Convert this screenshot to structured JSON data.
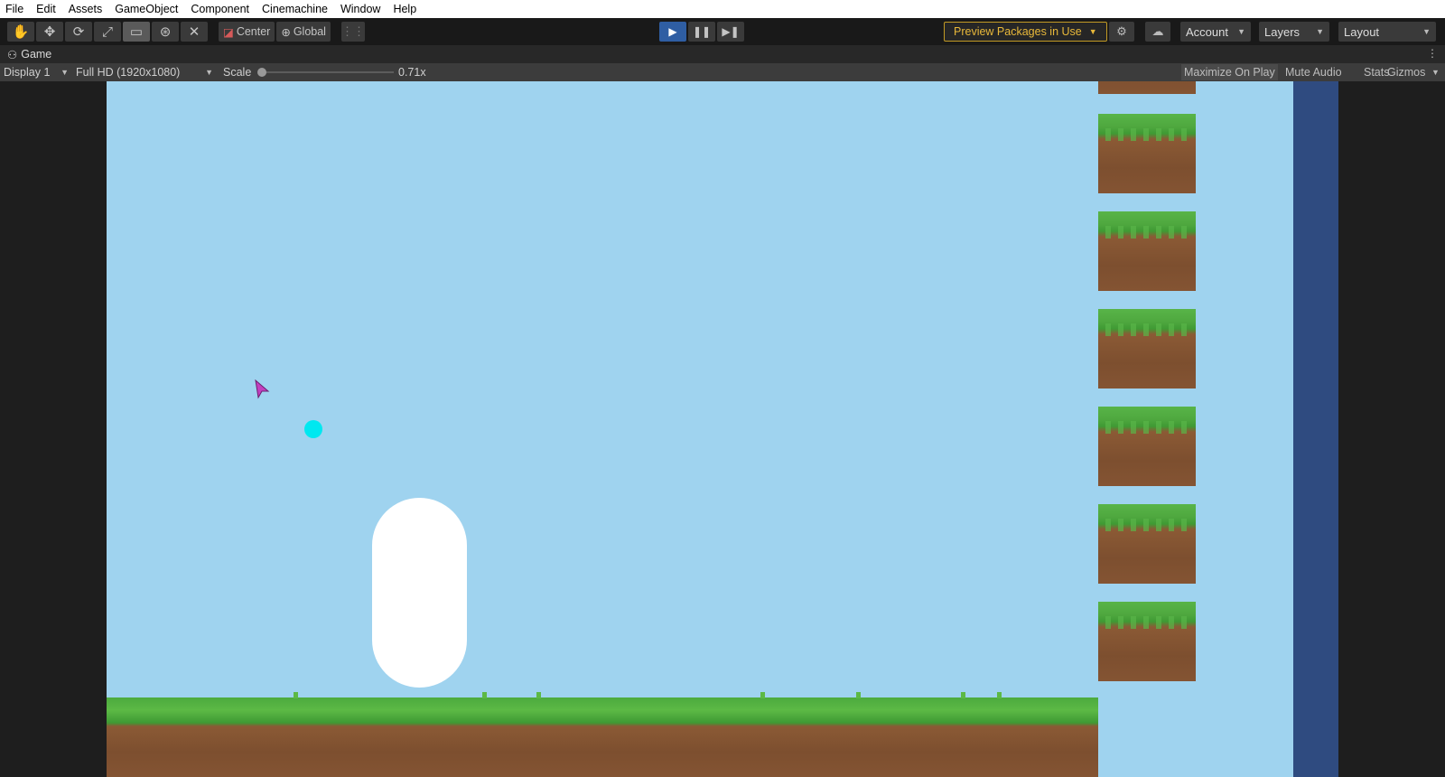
{
  "menu": [
    "File",
    "Edit",
    "Assets",
    "GameObject",
    "Component",
    "Cinemachine",
    "Window",
    "Help"
  ],
  "toolbar": {
    "tools": [
      "hand-tool-icon",
      "move-tool-icon",
      "rotate-tool-icon",
      "scale-tool-icon",
      "rect-tool-icon",
      "transform-tool-icon",
      "custom-tool-icon"
    ],
    "active_tool": "rect-tool-icon",
    "pivot_mode": "Center",
    "pivot_rotation": "Global",
    "play_state": "playing",
    "preview_packages": "Preview Packages in Use",
    "account": "Account",
    "layers": "Layers",
    "layout": "Layout"
  },
  "game_tab": {
    "title": "Game"
  },
  "game_bar": {
    "display": "Display 1",
    "resolution": "Full HD (1920x1080)",
    "scale_label": "Scale",
    "scale_value": "0.71x",
    "maximize_on_play": "Maximize On Play",
    "mute_audio": "Mute Audio",
    "stats": "Stats",
    "gizmos": "Gizmos"
  },
  "scene": {
    "sky_color": "#9fd3ef",
    "wall_color": "#2f4b80",
    "player_color": "#ffffff",
    "projectile_color": "#00e8f0",
    "grass_color": "#5cb945",
    "dirt_color": "#845433",
    "tile_column_count": 7
  }
}
